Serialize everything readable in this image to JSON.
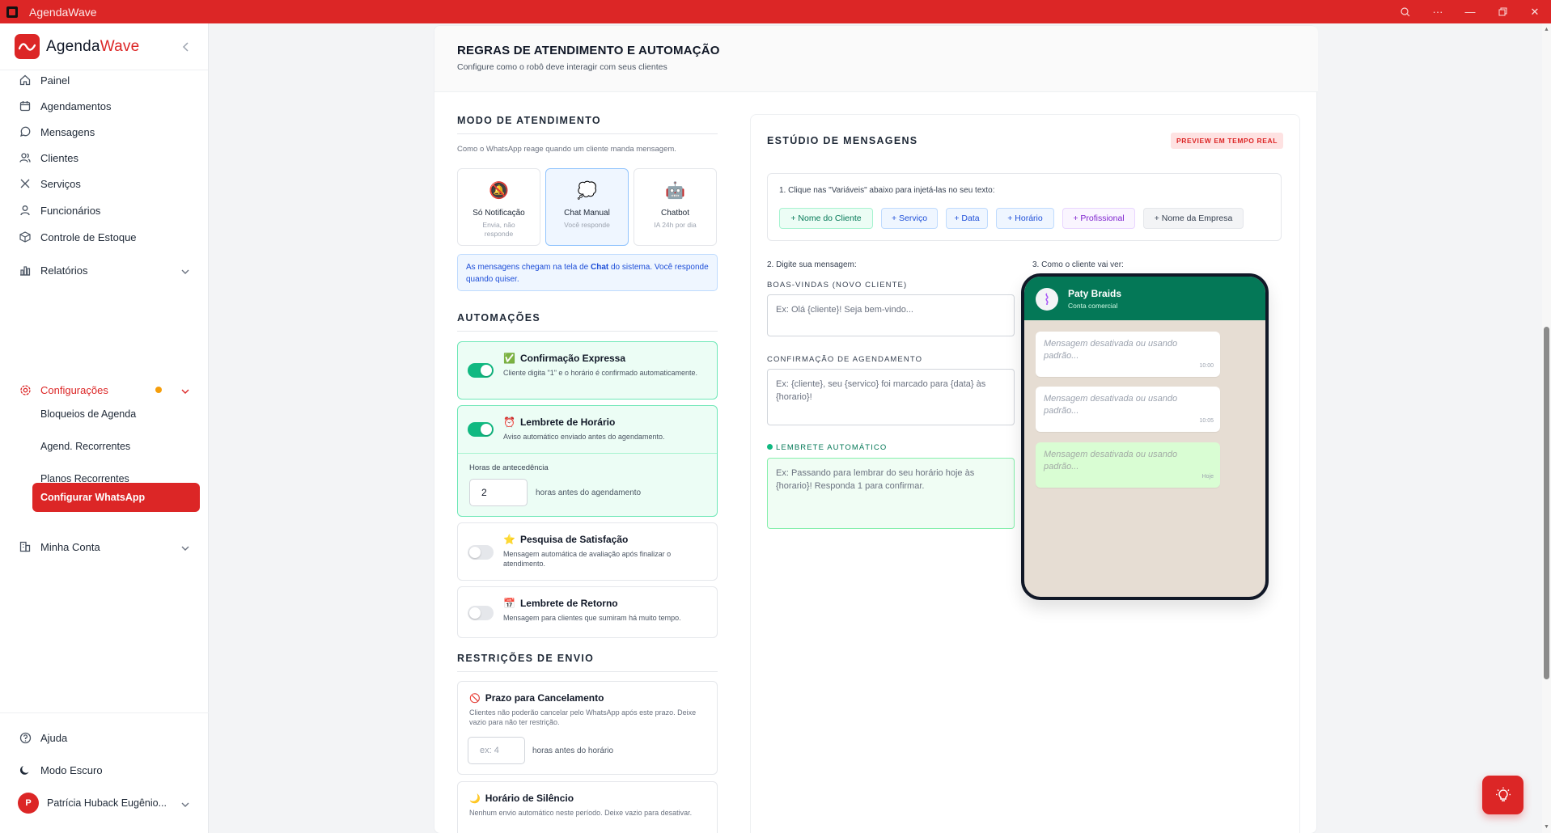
{
  "window": {
    "title": "AgendaWave"
  },
  "sidebar": {
    "brand_a": "Agenda",
    "brand_b": "Wave",
    "nav": [
      {
        "label": "Painel",
        "icon": "home-icon"
      },
      {
        "label": "Agendamentos",
        "icon": "calendar-icon"
      },
      {
        "label": "Mensagens",
        "icon": "message-icon"
      },
      {
        "label": "Clientes",
        "icon": "users-icon"
      },
      {
        "label": "Serviços",
        "icon": "scissors-icon"
      },
      {
        "label": "Funcionários",
        "icon": "user-icon"
      },
      {
        "label": "Controle de Estoque",
        "icon": "box-icon"
      },
      {
        "label": "Relatórios",
        "icon": "chart-icon"
      },
      {
        "label": "Configurações",
        "icon": "gear-icon"
      }
    ],
    "sub": [
      {
        "label": "Bloqueios de Agenda"
      },
      {
        "label": "Agend. Recorrentes"
      },
      {
        "label": "Planos Recorrentes"
      },
      {
        "label": "Configurar WhatsApp"
      }
    ],
    "account": {
      "label": "Minha Conta"
    },
    "bottom": {
      "help": "Ajuda",
      "dark_mode": "Modo Escuro",
      "user_initial": "P",
      "user_name": "Patrícia Huback Eugênio..."
    }
  },
  "page": {
    "title": "REGRAS DE ATENDIMENTO E AUTOMAÇÃO",
    "subtitle": "Configure como o robô deve interagir com seus clientes"
  },
  "mode": {
    "title": "MODO DE ATENDIMENTO",
    "desc": "Como o WhatsApp reage quando um cliente manda mensagem.",
    "options": [
      {
        "emoji": "🔕",
        "label": "Só Notificação",
        "desc": "Envia, não responde"
      },
      {
        "emoji": "💭",
        "label": "Chat Manual",
        "desc": "Você responde"
      },
      {
        "emoji": "🤖",
        "label": "Chatbot",
        "desc": "IA 24h por dia"
      }
    ],
    "info": "As mensagens chegam na tela de Chat do sistema. Você responde quando quiser."
  },
  "automations": {
    "title": "AUTOMAÇÕES",
    "items": [
      {
        "emoji": "✅",
        "title": "Confirmação Expressa",
        "desc": "Cliente digita \"1\" e o horário é confirmado automaticamente.",
        "enabled": true
      },
      {
        "emoji": "⏰",
        "title": "Lembrete de Horário",
        "desc": "Aviso automático enviado antes do agendamento.",
        "enabled": true
      },
      {
        "emoji": "⭐",
        "title": "Pesquisa de Satisfação",
        "desc": "Mensagem automática de avaliação após finalizar o atendimento.",
        "enabled": false
      },
      {
        "emoji": "📅",
        "title": "Lembrete de Retorno",
        "desc": "Mensagem para clientes que sumiram há muito tempo.",
        "enabled": false
      }
    ],
    "advance_label": "Horas de antecedência",
    "advance_value": "2",
    "advance_suffix": "horas antes do agendamento"
  },
  "restrictions": {
    "title": "RESTRIÇÕES DE ENVIO",
    "cancel_emoji": "🚫",
    "cancel_title": "Prazo para Cancelamento",
    "cancel_desc": "Clientes não poderão cancelar pelo WhatsApp após este prazo. Deixe vazio para não ter restrição.",
    "cancel_placeholder": "ex: 4",
    "cancel_suffix": "horas antes do horário",
    "silence_emoji": "🌙",
    "silence_title": "Horário de Silêncio",
    "silence_desc": "Nenhum envio automático neste período. Deixe vazio para desativar."
  },
  "studio": {
    "title": "ESTÚDIO DE MENSAGENS",
    "badge": "PREVIEW EM TEMPO REAL",
    "vars_label": "1. Clique nas \"Variáveis\" abaixo para injetá-las no seu texto:",
    "chips": [
      {
        "label": "+ Nome do Cliente",
        "color": "#047857",
        "bg": "#ecfdf5",
        "border": "#a7f3d0"
      },
      {
        "label": "+ Serviço",
        "color": "#1d4ed8",
        "bg": "#eff6ff",
        "border": "#bfdbfe"
      },
      {
        "label": "+ Data",
        "color": "#1d4ed8",
        "bg": "#eff6ff",
        "border": "#bfdbfe"
      },
      {
        "label": "+ Horário",
        "color": "#1d4ed8",
        "bg": "#eff6ff",
        "border": "#bfdbfe"
      },
      {
        "label": "+ Profissional",
        "color": "#7e22ce",
        "bg": "#faf5ff",
        "border": "#e9d5ff"
      },
      {
        "label": "+ Nome da Empresa",
        "color": "#374151",
        "bg": "#f3f4f6",
        "border": "#e5e7eb"
      }
    ],
    "type_label": "2. Digite sua mensagem:",
    "preview_label": "3. Como o cliente vai ver:",
    "welcome_label": "BOAS-VINDAS (NOVO CLIENTE)",
    "welcome_placeholder": "Ex: Olá {cliente}! Seja bem-vindo...",
    "confirm_label": "CONFIRMAÇÃO DE AGENDAMENTO",
    "confirm_placeholder": "Ex: {cliente}, seu {servico} foi marcado para {data} às {horario}!",
    "reminder_label": "LEMBRETE AUTOMÁTICO",
    "reminder_placeholder": "Ex: Passando para lembrar do seu horário hoje às {horario}! Responda 1 para confirmar."
  },
  "phone": {
    "name": "Paty Braids",
    "sub": "Conta comercial",
    "bubbles": [
      {
        "text": "Mensagem desativada ou usando padrão...",
        "time": "10:00"
      },
      {
        "text": "Mensagem desativada ou usando padrão...",
        "time": "10:05"
      },
      {
        "text": "Mensagem desativada ou usando padrão...",
        "time": "Hoje"
      }
    ]
  }
}
